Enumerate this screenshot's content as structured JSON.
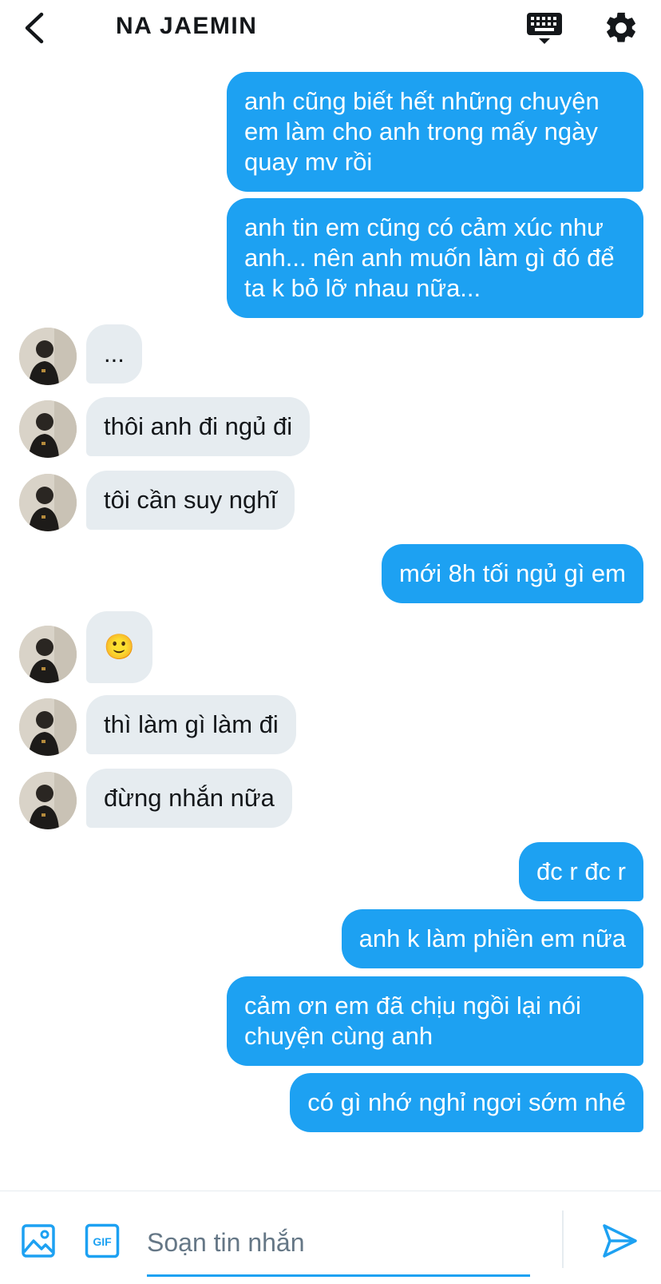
{
  "header": {
    "title": "NA JAEMIN",
    "back_icon": "chevron-left-icon",
    "keyboard_icon": "keyboard-icon",
    "settings_icon": "gear-icon"
  },
  "colors": {
    "accent": "#1da1f2",
    "incoming_bubble": "#e6ecf0",
    "text": "#14171a",
    "placeholder": "#657786"
  },
  "messages": [
    {
      "from": "me",
      "text": "anh cũng biết hết những chuyện em làm cho anh trong mấy ngày quay mv rồi"
    },
    {
      "from": "me",
      "text": "anh tin em cũng có cảm xúc như anh... nên anh muốn làm gì đó để ta k bỏ lỡ nhau nữa..."
    },
    {
      "from": "them",
      "text": "..."
    },
    {
      "from": "them",
      "text": "thôi anh đi ngủ đi"
    },
    {
      "from": "them",
      "text": "tôi cần suy nghĩ"
    },
    {
      "from": "me",
      "text": "mới 8h tối ngủ gì em"
    },
    {
      "from": "them",
      "text": "🙂"
    },
    {
      "from": "them",
      "text": "thì làm gì làm đi"
    },
    {
      "from": "them",
      "text": "đừng nhắn nữa"
    },
    {
      "from": "me",
      "text": "đc r đc r"
    },
    {
      "from": "me",
      "text": "anh k làm phiền em nữa"
    },
    {
      "from": "me",
      "text": "cảm ơn em đã chịu ngồi lại nói chuyện cùng anh"
    },
    {
      "from": "me",
      "text": "có gì nhớ nghỉ ngơi sớm nhé"
    }
  ],
  "composer": {
    "placeholder": "Soạn tin nhắn",
    "value": "",
    "image_icon": "image-icon",
    "gif_icon": "gif-icon",
    "gif_label": "GIF",
    "send_icon": "send-icon"
  }
}
